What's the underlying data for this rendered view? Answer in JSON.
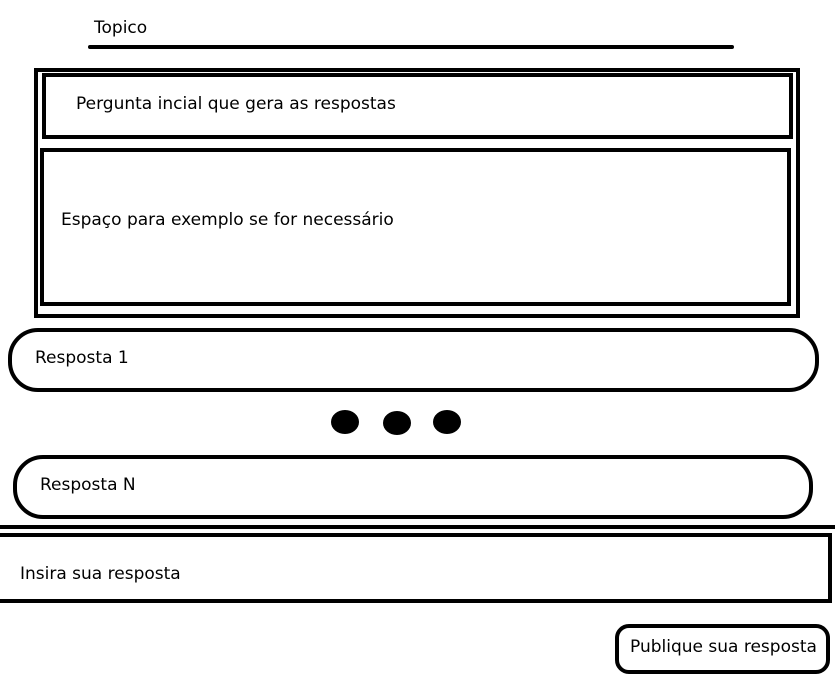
{
  "topic": {
    "label": "Topico"
  },
  "question": {
    "text": "Pergunta incial que gera as respostas"
  },
  "example": {
    "text": "Espaço para exemplo se for necessário"
  },
  "answers": [
    {
      "label": "Resposta 1"
    },
    {
      "label": "Resposta N"
    }
  ],
  "reply": {
    "placeholder": "Insira sua resposta"
  },
  "publish": {
    "label": "Publique sua resposta"
  }
}
